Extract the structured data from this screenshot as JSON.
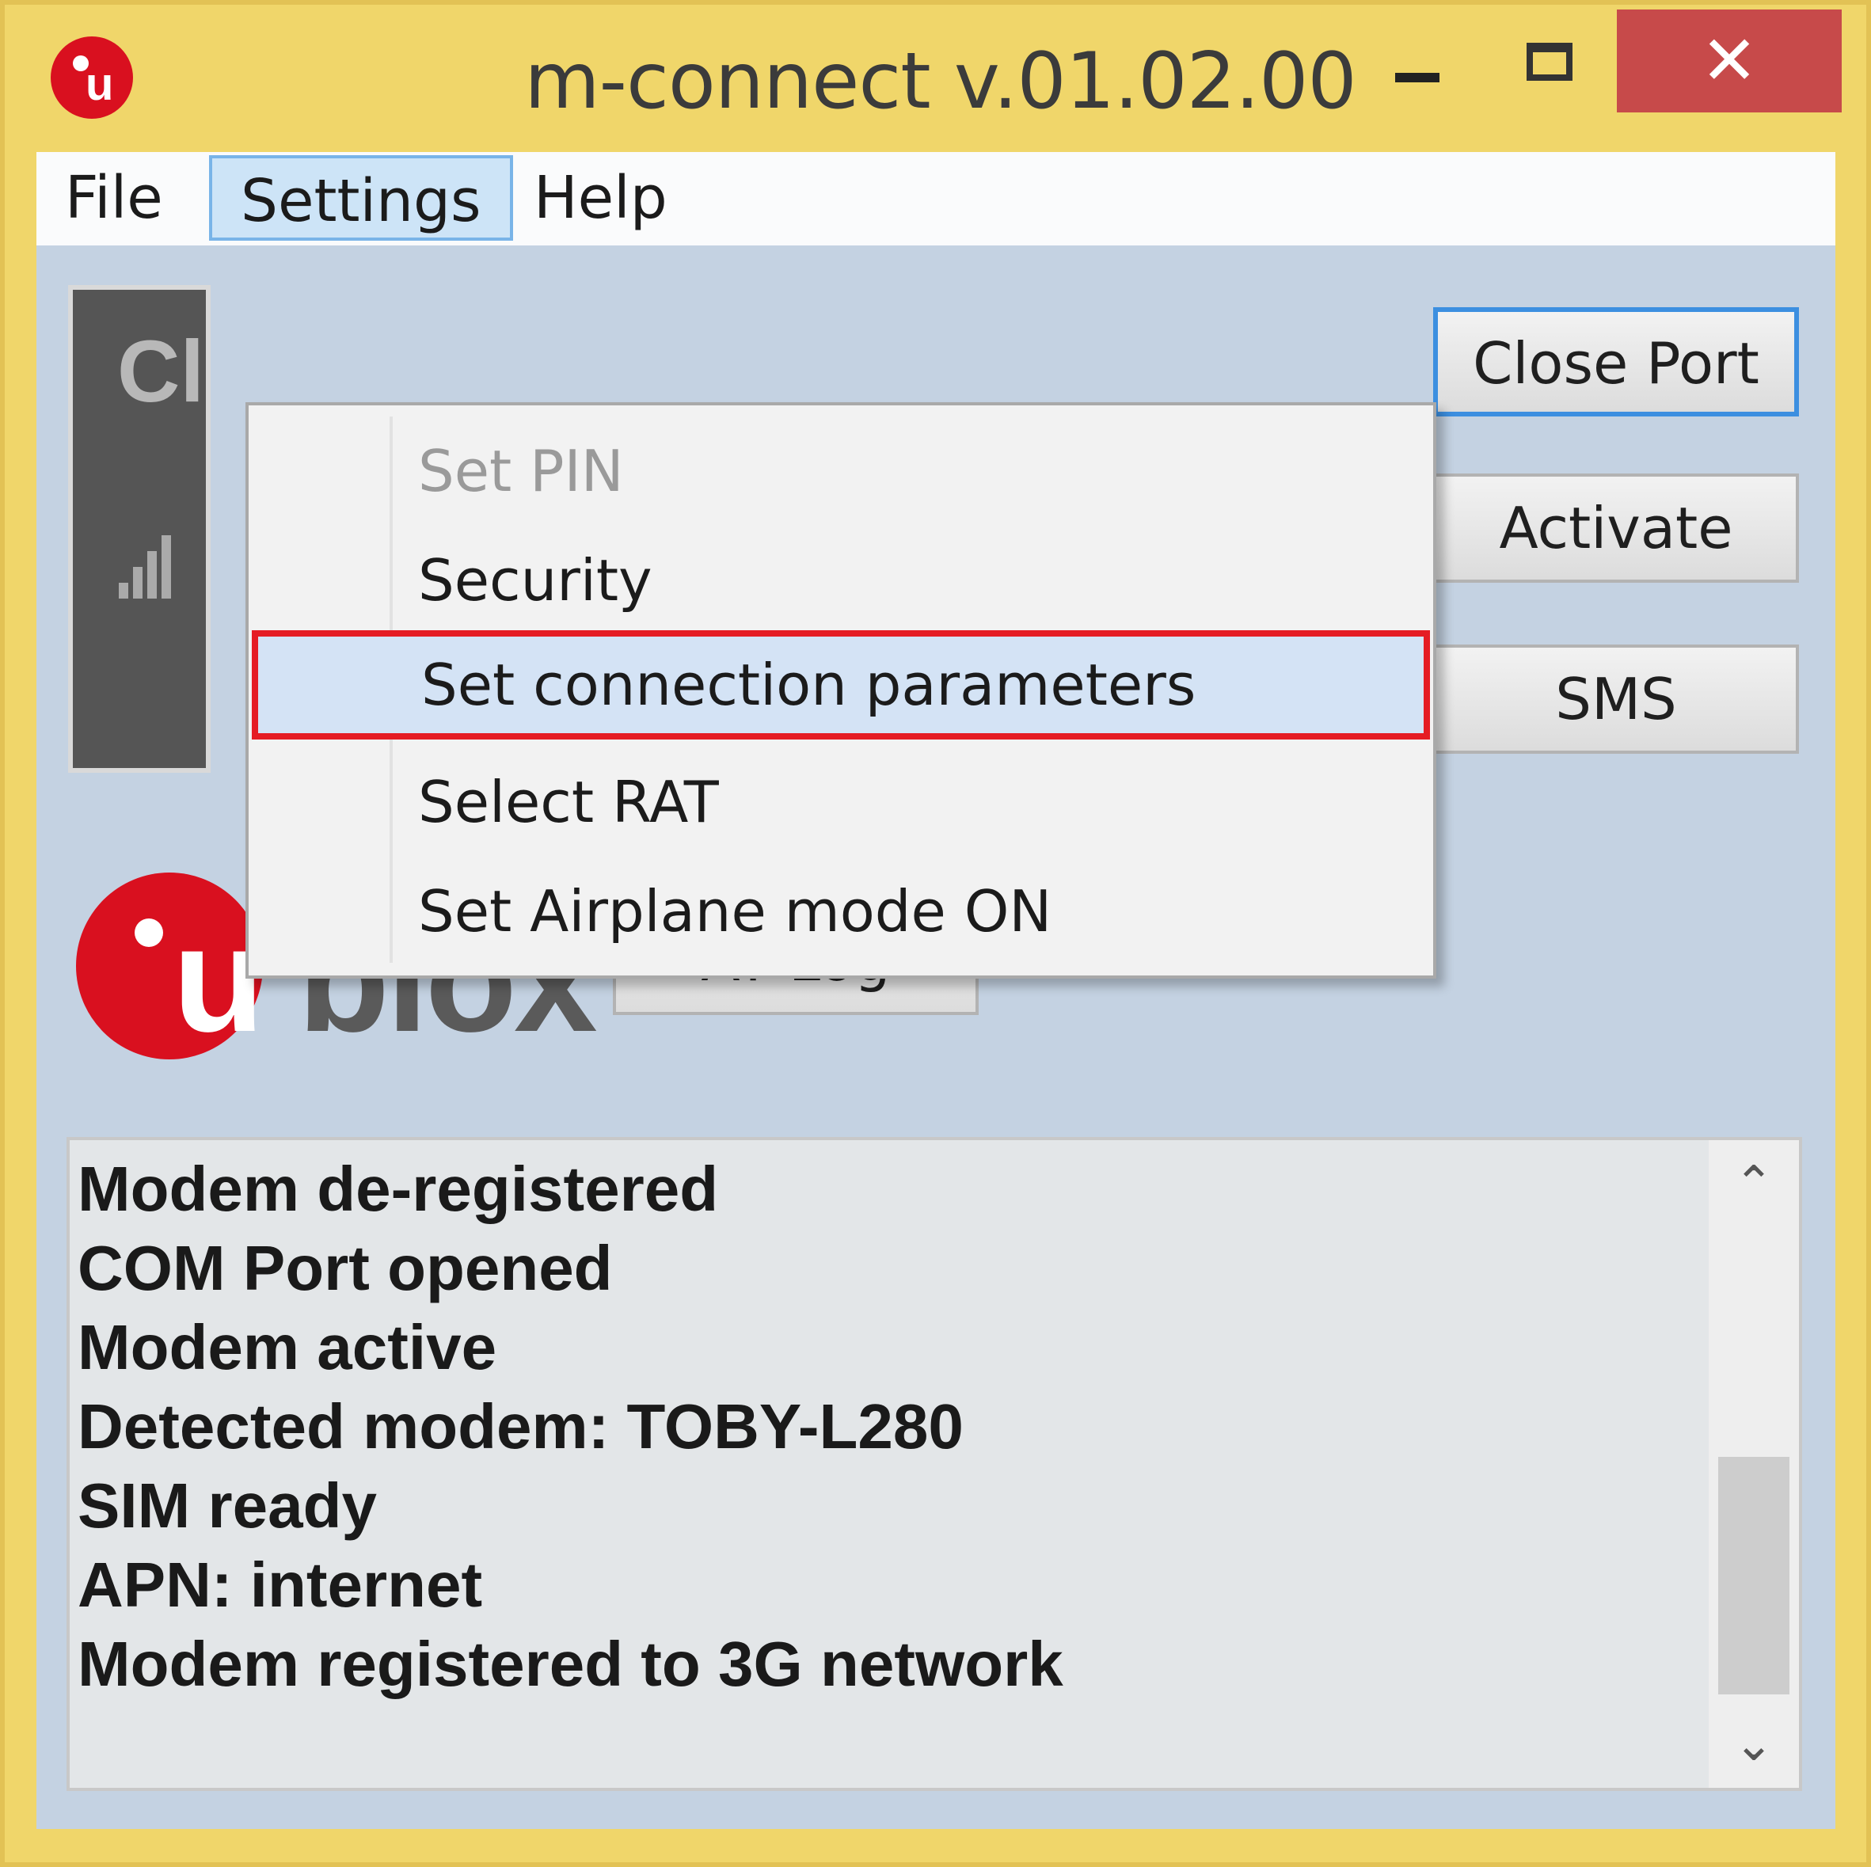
{
  "window": {
    "title": "m-connect v.01.02.00",
    "close_glyph": "✕"
  },
  "menubar": {
    "items": [
      "File",
      "Settings",
      "Help"
    ],
    "active": "Settings"
  },
  "settings_menu": {
    "items": [
      {
        "label": "Set PIN",
        "state": "disabled"
      },
      {
        "label": "Security",
        "state": "normal"
      },
      {
        "label": "Set connection parameters",
        "state": "highlighted"
      },
      {
        "label": "Select RAT",
        "state": "normal"
      },
      {
        "label": "Set Airplane mode ON",
        "state": "normal"
      }
    ]
  },
  "status_panel": {
    "text": "Cl",
    "icon": "signal-icon"
  },
  "buttons": {
    "close_port": "Close Port",
    "activate": "Activate",
    "sms": "SMS",
    "at_log": "AT Log"
  },
  "logo": {
    "u": "u",
    "rest": "blox"
  },
  "log": {
    "lines": [
      "Modem de-registered",
      "COM Port opened",
      "Modem active",
      "Detected modem: TOBY-L280",
      "SIM ready",
      "APN: internet",
      "Modem registered to 3G network"
    ],
    "scroll_up_glyph": "⌃",
    "scroll_down_glyph": "⌄"
  },
  "colors": {
    "title_bar": "#f0d66a",
    "close_button": "#c74a4a",
    "client_bg": "#c4d2e2",
    "highlight_border": "#e51c24",
    "brand_red": "#d9101f"
  }
}
